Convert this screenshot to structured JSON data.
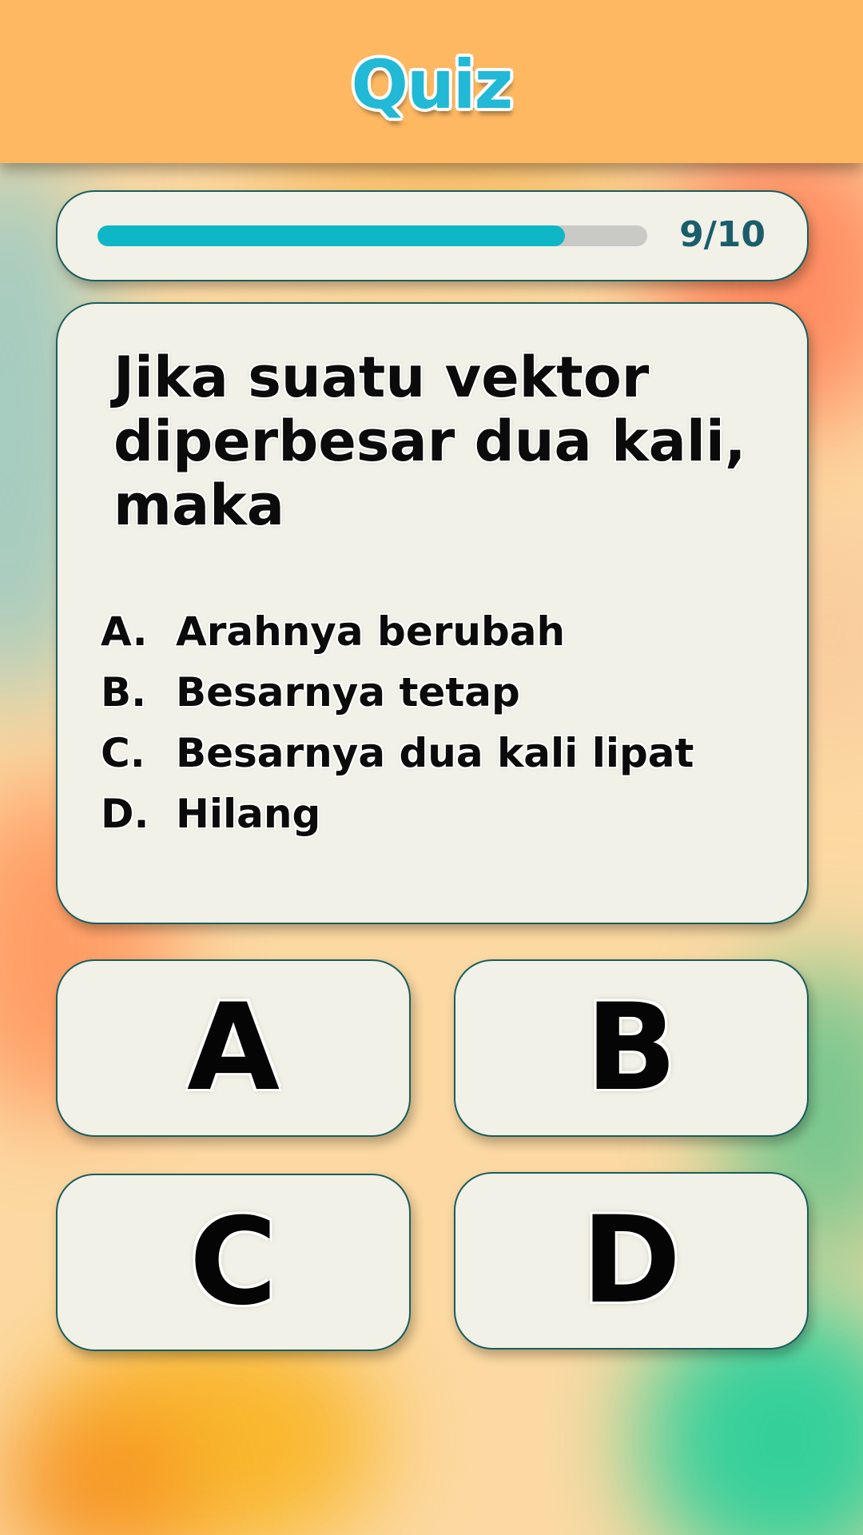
{
  "header": {
    "title": "Quiz"
  },
  "progress": {
    "current": 9,
    "total": 10,
    "fraction": 0.85,
    "label": "9/10",
    "fill_color": "#0eb7c6"
  },
  "question": {
    "text": "Jika suatu vektor diperbesar dua kali, maka",
    "options": [
      {
        "letter": "A.",
        "text": "Arahnya berubah"
      },
      {
        "letter": "B.",
        "text": "Besarnya tetap"
      },
      {
        "letter": "C.",
        "text": "Besarnya dua kali lipat"
      },
      {
        "letter": "D.",
        "text": "Hilang"
      }
    ]
  },
  "answers": {
    "a": "A",
    "b": "B",
    "c": "C",
    "d": "D"
  },
  "colors": {
    "header_bg": "#feb862",
    "title": "#21b9d6",
    "card_bg": "#f1f1e7",
    "card_border": "#1a5d5c",
    "progress_text": "#1b5d6b"
  }
}
